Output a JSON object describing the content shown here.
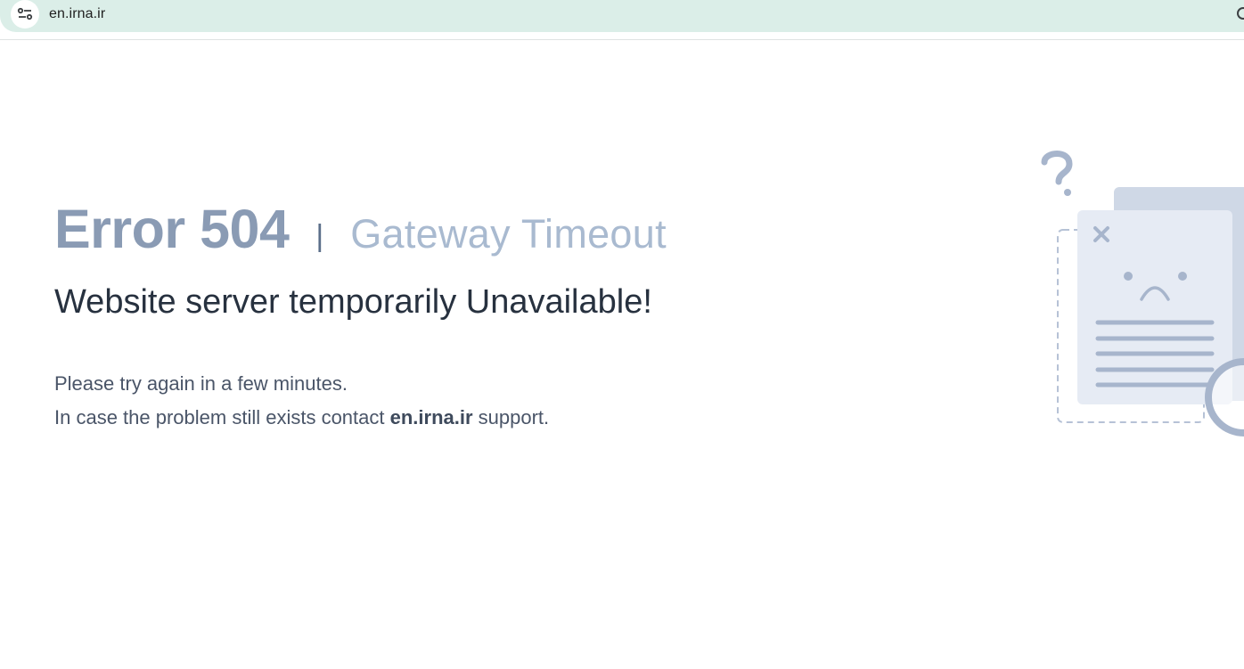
{
  "browser": {
    "url": "en.irna.ir",
    "site_info_icon": "tune-icon"
  },
  "error": {
    "code": "Error 504",
    "separator": "|",
    "title": "Gateway Timeout",
    "subtitle": "Website server temporarily Unavailable!",
    "line1": "Please try again in a few minutes.",
    "line2_prefix": "In case the problem still exists contact ",
    "line2_domain": "en.irna.ir",
    "line2_suffix": " support."
  },
  "illustration": {
    "icon": "sad-document-icon",
    "colors": {
      "light": "#e6ebf4",
      "mid": "#cfd8e6",
      "dark": "#a7b5cc"
    }
  }
}
